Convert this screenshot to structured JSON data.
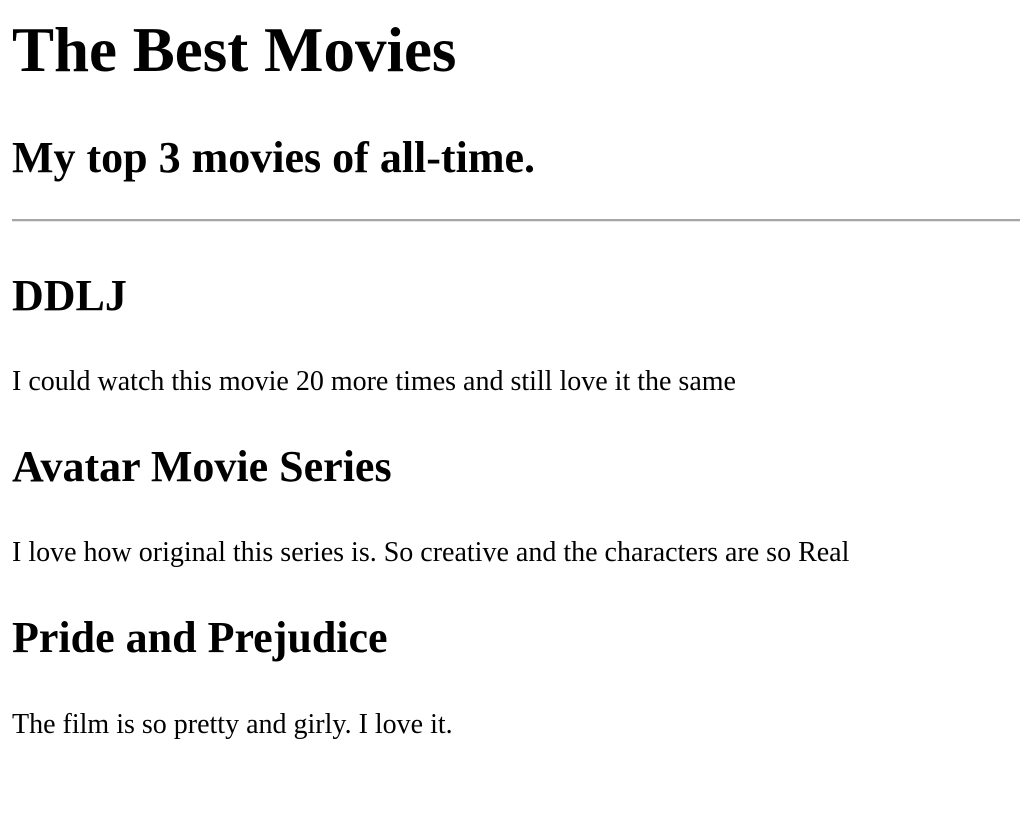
{
  "page": {
    "title": "The Best Movies",
    "subtitle": "My top 3 movies of all-time."
  },
  "movies": [
    {
      "title": "DDLJ",
      "description": "I could watch this movie 20 more times and still love it the same"
    },
    {
      "title": "Avatar Movie Series",
      "description": "I love how original this series is. So creative and the characters are so Real"
    },
    {
      "title": "Pride and Prejudice",
      "description": "The film is so pretty and girly. I love it."
    }
  ],
  "colors": {
    "text": "#000000",
    "background": "#ffffff",
    "divider": "#a6a6a6"
  }
}
